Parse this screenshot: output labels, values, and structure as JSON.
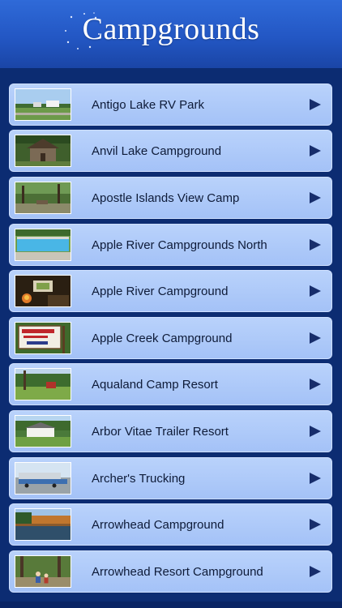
{
  "header": {
    "title": "Campgrounds"
  },
  "colors": {
    "header_top": "#2f6ad8",
    "header_bottom": "#1a45a6",
    "list_background": "#0c2c72",
    "row_fill": "#b9d2fb",
    "row_text": "#0e1b38",
    "arrow": "#172d6b"
  },
  "icons": {
    "row_arrow": "play-arrow-icon",
    "title_decoration": "sparkle-icon"
  },
  "items": [
    {
      "label": "Antigo Lake RV Park",
      "thumb": "rv-park-photo"
    },
    {
      "label": "Anvil Lake Campground",
      "thumb": "stone-cabin-photo"
    },
    {
      "label": "Apostle Islands View Camp",
      "thumb": "wooded-campsite-photo"
    },
    {
      "label": "Apple River Campgrounds North",
      "thumb": "swimming-pool-photo"
    },
    {
      "label": "Apple River Campground",
      "thumb": "campfire-photo"
    },
    {
      "label": "Apple Creek Campground",
      "thumb": "campground-sign-photo"
    },
    {
      "label": "Aqualand Camp Resort",
      "thumb": "camp-resort-photo"
    },
    {
      "label": "Arbor Vitae Trailer Resort",
      "thumb": "trailer-house-photo"
    },
    {
      "label": "Archer's Trucking",
      "thumb": "trucks-photo"
    },
    {
      "label": "Arrowhead Campground",
      "thumb": "lake-view-photo"
    },
    {
      "label": "Arrowhead Resort Campground",
      "thumb": "forest-family-photo"
    }
  ]
}
